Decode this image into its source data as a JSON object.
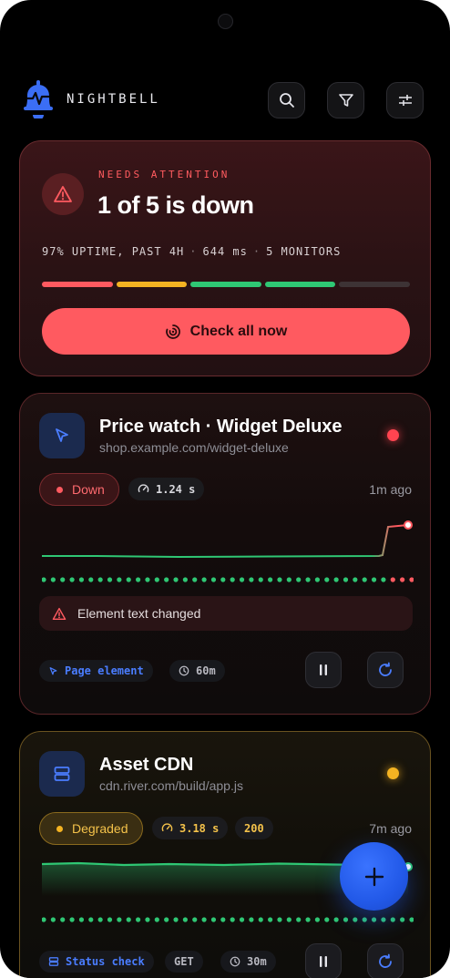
{
  "app": {
    "brand": "NIGHTBELL"
  },
  "colors": {
    "red": "#ff5a60",
    "amber": "#f4b322",
    "green": "#2fc774",
    "blue": "#3b6ef5"
  },
  "summary": {
    "eyebrow": "NEEDS ATTENTION",
    "headline": "1 of 5 is down",
    "stat_uptime": "97% UPTIME, PAST 4H",
    "stat_latency": "644 ms",
    "stat_monitors": "5 MONITORS",
    "segments": [
      "down",
      "degraded",
      "up",
      "up",
      "unknown"
    ],
    "check_button": "Check all now"
  },
  "monitors": [
    {
      "title": "Price watch · Widget Deluxe",
      "url": "shop.example.com/widget-deluxe",
      "status": "Down",
      "latency": "1.24 s",
      "last_checked": "1m ago",
      "alert": "Element text changed",
      "type_label": "Page element",
      "interval": "60m",
      "history": [
        "up",
        "up",
        "up",
        "up",
        "up",
        "up",
        "up",
        "up",
        "up",
        "up",
        "up",
        "up",
        "up",
        "up",
        "up",
        "up",
        "up",
        "up",
        "up",
        "up",
        "up",
        "up",
        "up",
        "up",
        "up",
        "up",
        "up",
        "up",
        "up",
        "up",
        "up",
        "up",
        "up",
        "up",
        "up",
        "up",
        "up",
        "down",
        "down",
        "down"
      ]
    },
    {
      "title": "Asset CDN",
      "url": "cdn.river.com/build/app.js",
      "status": "Degraded",
      "latency": "3.18 s",
      "http_code": "200",
      "last_checked": "7m ago",
      "type_label": "Status check",
      "method": "GET",
      "interval": "30m",
      "history": [
        "up",
        "up",
        "up",
        "up",
        "up",
        "up",
        "up",
        "up",
        "up",
        "up",
        "up",
        "up",
        "up",
        "up",
        "up",
        "up",
        "up",
        "up",
        "up",
        "up",
        "up",
        "up",
        "up",
        "up",
        "up",
        "up",
        "up",
        "up",
        "up",
        "up",
        "up",
        "up",
        "up",
        "up",
        "up",
        "up",
        "up",
        "up",
        "up",
        "up"
      ]
    }
  ],
  "fab": {
    "icon": "plus-icon"
  }
}
